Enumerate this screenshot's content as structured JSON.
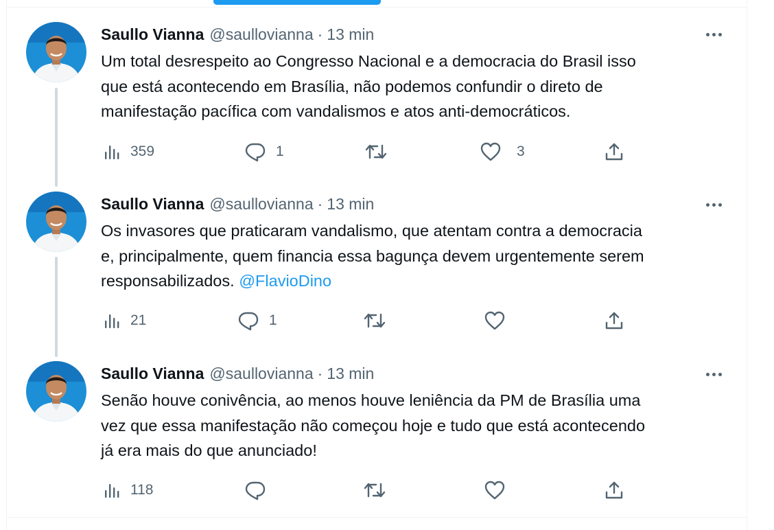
{
  "tweets": [
    {
      "name": "Saullo Vianna",
      "handle": "@saullovianna",
      "separator": "·",
      "time": "13 min",
      "text_lines": [
        "Um total desrespeito ao Congresso Nacional e a democracia do Brasil isso",
        "que está acontecendo em Brasília, não podemos confundir o direto de",
        "manifestação pacífica com vandalismos e atos anti-democráticos."
      ],
      "mention": "",
      "views": "359",
      "replies": "1",
      "retweets": "",
      "likes": "3"
    },
    {
      "name": "Saullo Vianna",
      "handle": "@saullovianna",
      "separator": "·",
      "time": "13 min",
      "text_lines": [
        "Os invasores que praticaram vandalismo, que atentam contra a democracia",
        "e, principalmente, quem financia essa bagunça devem urgentemente serem",
        "responsabilizados. "
      ],
      "mention": "@FlavioDino",
      "views": "21",
      "replies": "1",
      "retweets": "",
      "likes": ""
    },
    {
      "name": "Saullo Vianna",
      "handle": "@saullovianna",
      "separator": "·",
      "time": "13 min",
      "text_lines": [
        "Senão houve conivência, ao menos houve leniência da PM de Brasília uma",
        "vez que essa manifestação não começou hoje e tudo que está acontecendo",
        "já era mais do que anunciado!"
      ],
      "mention": "",
      "views": "118",
      "replies": "",
      "retweets": "",
      "likes": ""
    }
  ],
  "icons": {
    "views": "bar-chart-icon",
    "reply": "speech-bubble-icon",
    "retweet": "retweet-arrows-icon",
    "like": "heart-icon",
    "share": "share-upload-icon",
    "more": "more-dots-icon"
  },
  "colors": {
    "accent": "#1d9bf0",
    "text": "#0f1419",
    "muted": "#536471",
    "thread_line": "#cfd9de",
    "avatar_bg": "#1c8fd6"
  }
}
